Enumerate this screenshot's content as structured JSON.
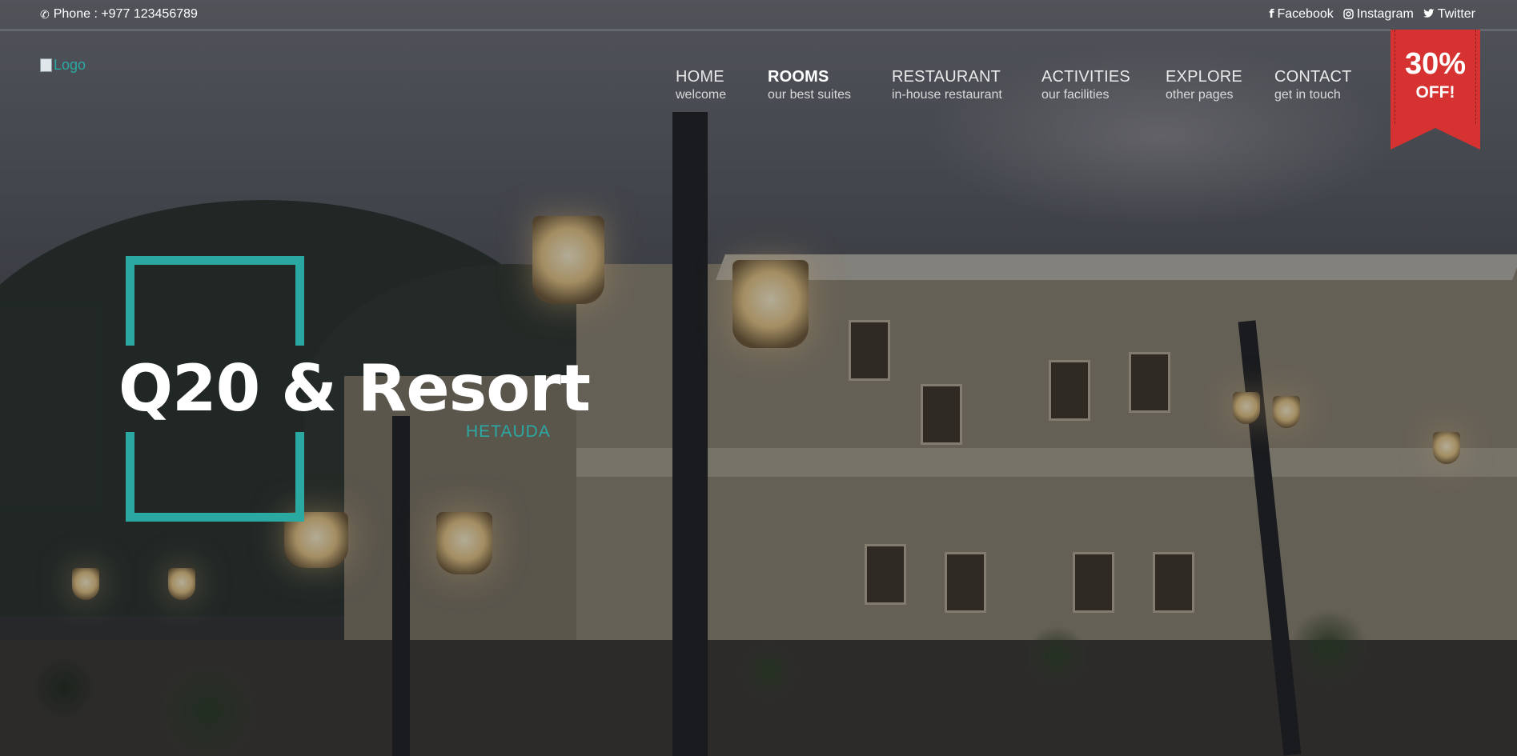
{
  "topbar": {
    "phone_icon": "phone-icon",
    "phone": "Phone : +977 123456789",
    "socials": [
      {
        "icon": "facebook-icon",
        "label": "Facebook"
      },
      {
        "icon": "instagram-icon",
        "label": "Instagram"
      },
      {
        "icon": "twitter-icon",
        "label": "Twitter"
      }
    ]
  },
  "logo": {
    "alt": "Logo"
  },
  "nav": [
    {
      "title": "HOME",
      "sub": "welcome",
      "active": false
    },
    {
      "title": "ROOMS",
      "sub": "our best suites",
      "active": true
    },
    {
      "title": "RESTAURANT",
      "sub": "in-house restaurant",
      "active": false
    },
    {
      "title": "ACTIVITIES",
      "sub": "our facilities",
      "active": false
    },
    {
      "title": "EXPLORE",
      "sub": "other pages",
      "active": false
    },
    {
      "title": "CONTACT",
      "sub": "get in touch",
      "active": false
    }
  ],
  "promo": {
    "percent": "30%",
    "label": "OFF!",
    "color": "#d63232"
  },
  "hero": {
    "title": "Q20 & Resort",
    "subtitle": "HETAUDA",
    "accent": "#2aa9a3"
  }
}
